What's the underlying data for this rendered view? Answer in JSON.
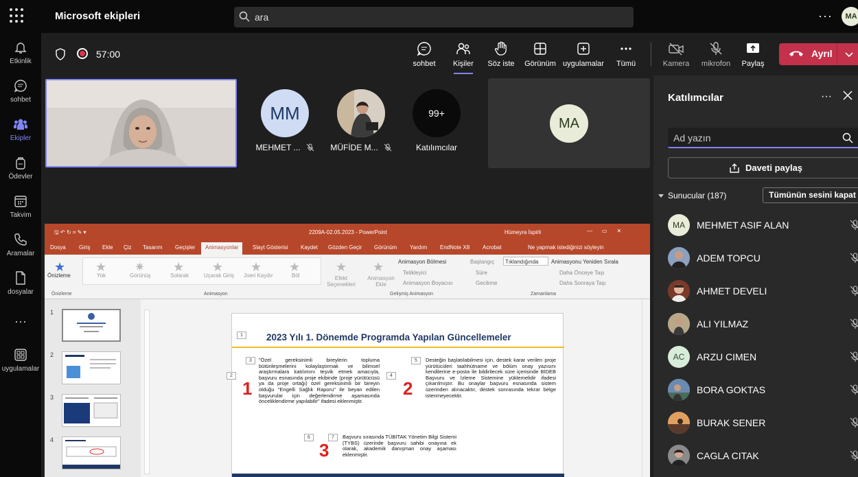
{
  "app": {
    "title": "Microsoft ekipleri",
    "user_initials": "MA"
  },
  "search": {
    "placeholder": "ara"
  },
  "rail": [
    {
      "label": "Etkinlik",
      "icon": "bell-icon"
    },
    {
      "label": "sohbet",
      "icon": "chat-icon"
    },
    {
      "label": "Ekipler",
      "icon": "teams-icon"
    },
    {
      "label": "Ödevler",
      "icon": "backpack-icon"
    },
    {
      "label": "Takvim",
      "icon": "calendar-icon"
    },
    {
      "label": "Aramalar",
      "icon": "phone-icon"
    },
    {
      "label": "dosyalar",
      "icon": "file-icon"
    },
    {
      "label": "uygulamalar",
      "icon": "apps-icon"
    }
  ],
  "meeting": {
    "timer": "57:00",
    "controls": {
      "chat": "sohbet",
      "people": "Kişiler",
      "raise_hand": "Söz iste",
      "view": "Görünüm",
      "apps": "uygulamalar",
      "more": "Tümü",
      "camera": "Kamera",
      "mic": "mikrofon",
      "share": "Paylaş",
      "leave": "Ayrıl"
    }
  },
  "stage": {
    "tiles": [
      {
        "initials": "MM",
        "name": "MEHMET ..."
      },
      {
        "initials": "",
        "name": "MÜFİDE M..."
      },
      {
        "initials": "99+",
        "name": "Katılımcılar"
      }
    ],
    "ma_tile": {
      "initials": "MA"
    }
  },
  "ppt": {
    "window_title": "2209A-02.05.2023  -  PowerPoint",
    "user": "Hümeyra İspirli",
    "tabs": [
      "Dosya",
      "Giriş",
      "Ekle",
      "Çiz",
      "Tasarım",
      "Geçişler",
      "Animasyonlar",
      "Slayt Gösterisi",
      "Kaydet",
      "Gözden Geçir",
      "Görünüm",
      "Yardım",
      "EndNote X8",
      "Acrobat",
      "Ne yapmak istediğinizi söyleyin"
    ],
    "ribbon": {
      "preview": "Önizleme",
      "effects": [
        "Yok",
        "Görünüş",
        "Solarak",
        "Uçarak Giriş",
        "Joeri Kaydır",
        "Böl"
      ],
      "effect_options": "Efekt Seçenekleri",
      "add_anim": "Animasyon Ekle",
      "anim_pane": "Animasyon Bölmesi",
      "trigger": "Tetikleyici",
      "anim_painter": "Animasyon Boyacısı",
      "start": "Başlangıç",
      "start_value": "Tıklandığında",
      "duration": "Süre",
      "delay": "Gecikme",
      "reorder": "Animasyonu Yeniden Sırala",
      "earlier": "Daha Önceye Taşı",
      "later": "Daha Sonraya Taşı",
      "groups": [
        "Önizleme",
        "Animasyon",
        "Gelişmiş Animasyon",
        "Zamanlama"
      ]
    },
    "slide": {
      "title": "2023 Yılı 1. Dönemde Programda Yapılan Güncellemeler",
      "p1": "\"Özel gereksinimli bireylerin topluma bütünleşmelerini kolaylaştırmak ve bilimsel araştırmalara katılımını teşvik etmek amacıyla, başvuru esnasında proje ekibinde (proje yürütücüsü ya da proje ortağı) özel gereksinimli bir bireyin olduğu \"Engelli Sağlık Raporu\" ile beyan edilen başvurular için değerlendirme aşamasında önceliklendirme yapılabilir\" ifadesi eklenmiştir.",
      "p2": "Desteğin başlatılabilmesi için, destek karar verilen proje yürütücüleri taahhütname ve bölüm onay yazısını kendilerine e-posta ile bildirilecek süre içerisinde BİDEB Başvuru ve İzleme Sistemine yüklemelidir ifadesi çıkarılmıştır. Bu onaylar başvuru esnasında sistem üzerinden alınacaktır, destek sonrasında tekrar belge istenmeyecektir.",
      "p3": "Başvuru sırasında TÜBİTAK Yönetim Bilgi Sistemi (TYBS) üzerinde başvuru sahibi onayına ek olarak, akademik danışman onay aşaması eklenmiştir.",
      "n1": "1",
      "n2": "2",
      "n3": "3",
      "boxes": [
        "1",
        "2",
        "3",
        "4",
        "5",
        "6",
        "7"
      ]
    },
    "thumbs": [
      "1",
      "2",
      "3",
      "4"
    ]
  },
  "panel": {
    "title": "Katılımcılar",
    "search_placeholder": "Ad yazın",
    "share_invite": "Daveti paylaş",
    "presenters": "Sunucular (187)",
    "mute_all": "Tümünün sesini kapat",
    "people": [
      {
        "name": "MEHMET ASIF ALAN",
        "initials": "MA",
        "color": "#e8ecd9"
      },
      {
        "name": "ADEM TOPCU",
        "initials": "",
        "color": "#6b7fa0"
      },
      {
        "name": "AHMET DEVELI",
        "initials": "",
        "color": "#8a4a3a"
      },
      {
        "name": "ALI YILMAZ",
        "initials": "",
        "color": "#9a8a6a"
      },
      {
        "name": "ARZU CIMEN",
        "initials": "AC",
        "color": "#d8ecd9"
      },
      {
        "name": "BORA GOKTAS",
        "initials": "",
        "color": "#5a7a8a"
      },
      {
        "name": "BURAK SENER",
        "initials": "",
        "color": "#c07840"
      },
      {
        "name": "CAGLA CITAK",
        "initials": "",
        "color": "#606060"
      }
    ]
  }
}
